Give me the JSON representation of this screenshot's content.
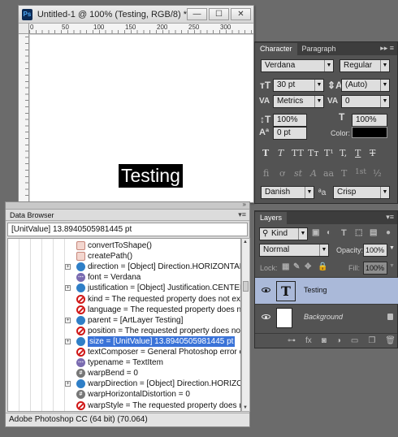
{
  "document": {
    "app_badge": "Ps",
    "title": "Untitled-1 @ 100% (Testing, RGB/8) *",
    "controls": {
      "minimize": "—",
      "maximize": "☐",
      "close": "✕"
    },
    "ruler_marks": [
      "0",
      "50",
      "100",
      "150",
      "200",
      "250",
      "300"
    ],
    "canvas_text": "Testing"
  },
  "data_browser": {
    "title": "Data Browser",
    "menu": "▾≡",
    "collapse": "»",
    "value": "[UnitValue] 13.8940505981445 pt",
    "rows": [
      {
        "icon": "method",
        "text": "convertToShape()"
      },
      {
        "icon": "method",
        "text": "createPath()"
      },
      {
        "icon": "object",
        "text": "direction = [Object] Direction.HORIZONTAL"
      },
      {
        "icon": "string",
        "text": "font = Verdana"
      },
      {
        "icon": "object",
        "text": "justification = [Object] Justification.CENTER"
      },
      {
        "icon": "error",
        "text": "kind = The requested property does not exist"
      },
      {
        "icon": "error",
        "text": "language = The requested property does not"
      },
      {
        "icon": "object",
        "text": "parent = [ArtLayer Testing]"
      },
      {
        "icon": "error",
        "text": "position = The requested property does not"
      },
      {
        "icon": "object",
        "text": "size = [UnitValue] 13.8940505981445 pt"
      },
      {
        "icon": "error",
        "text": "textComposer = General Photoshop error oc"
      },
      {
        "icon": "string",
        "text": "typename = TextItem"
      },
      {
        "icon": "number",
        "text": "warpBend = 0"
      },
      {
        "icon": "object",
        "text": "warpDirection = [Object] Direction.HORIZO"
      },
      {
        "icon": "number",
        "text": "warpHorizontalDistortion = 0"
      },
      {
        "icon": "error",
        "text": "warpStyle = The requested property does no"
      }
    ],
    "selected_row_index": 9,
    "status": "Adobe Photoshop CC (64 bit) (70.064)"
  },
  "character_panel": {
    "tabs": [
      "Character",
      "Paragraph"
    ],
    "menu": "▸▸ ≡",
    "font_family": "Verdana",
    "font_style": "Regular",
    "font_size": "30 pt",
    "leading": "(Auto)",
    "kerning": "Metrics",
    "tracking": "0",
    "vertical_scale": "100%",
    "horizontal_scale": "100%",
    "baseline_shift": "0 pt",
    "color_label": "Color:",
    "color_value": "#000000",
    "type_buttons": [
      "T",
      "T",
      "TT",
      "Tт",
      "T¹",
      "T,",
      "T",
      "T"
    ],
    "opentype_buttons": [
      "fi",
      "ơ",
      "st",
      "A",
      "aa",
      "T",
      "1st",
      "½"
    ],
    "language": "Danish",
    "aa_label": "ªa",
    "antialias": "Crisp"
  },
  "layers_panel": {
    "tab": "Layers",
    "menu": "▾≡",
    "filter": "Kind",
    "blend_mode": "Normal",
    "opacity_label": "Opacity:",
    "opacity_value": "100%",
    "lock_label": "Lock:",
    "fill_label": "Fill:",
    "fill_value": "100%",
    "layers": [
      {
        "name": "Testing",
        "type": "text",
        "selected": true
      },
      {
        "name": "Background",
        "type": "background",
        "selected": false
      }
    ],
    "bottom_icons": [
      "link-icon",
      "fx-icon",
      "mask-icon",
      "adjustment-icon",
      "folder-icon",
      "new-layer-icon",
      "trash-icon"
    ]
  }
}
